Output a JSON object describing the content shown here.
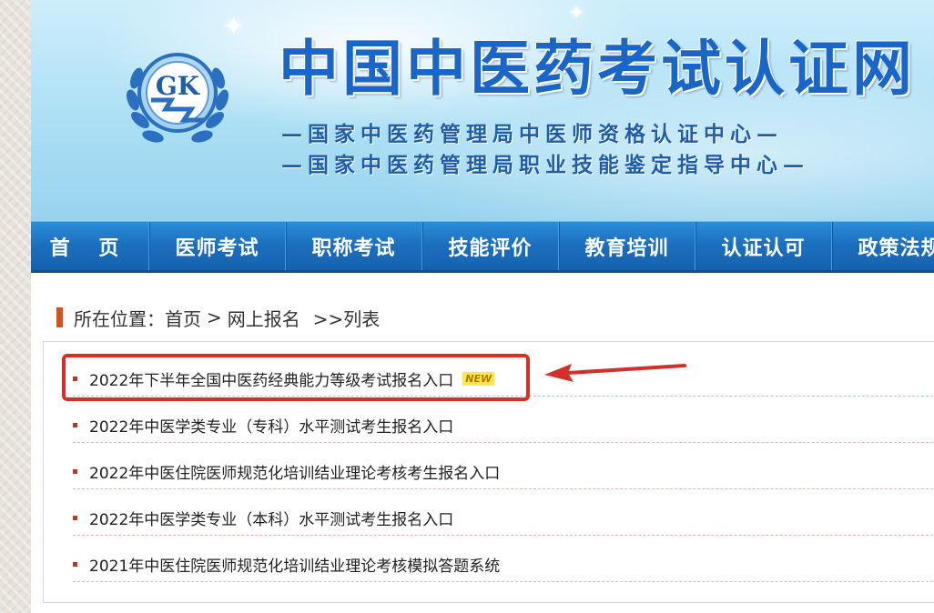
{
  "site": {
    "logo_text": "GK",
    "title": "中国中医药考试认证网",
    "subtitle1": "—国家中医药管理局中医师资格认证中心—",
    "subtitle2": "—国家中医药管理局职业技能鉴定指导中心—"
  },
  "nav": {
    "items": [
      {
        "label": "首 页"
      },
      {
        "label": "医师考试"
      },
      {
        "label": "职称考试"
      },
      {
        "label": "技能评价"
      },
      {
        "label": "教育培训"
      },
      {
        "label": "认证认可"
      },
      {
        "label": "政策法规"
      }
    ]
  },
  "breadcrumb": {
    "prefix": "所在位置：",
    "home": "首页",
    "separator": ">",
    "current": "网上报名",
    "tail": ">>列表"
  },
  "list": {
    "items": [
      {
        "title": "2022年下半年全国中医药经典能力等级考试报名入口",
        "badge": "NEW"
      },
      {
        "title": "2022年中医学类专业（专科）水平测试考生报名入口"
      },
      {
        "title": "2022年中医住院医师规范化培训结业理论考核考生报名入口"
      },
      {
        "title": "2022年中医学类专业（本科）水平测试考生报名入口"
      },
      {
        "title": "2021年中医住院医师规范化培训结业理论考核模拟答题系统"
      }
    ]
  },
  "colors": {
    "nav_bg": "#1c70c0",
    "title": "#1a66c8",
    "annotation_red": "#d3302a",
    "bullet": "#b23a2a"
  },
  "icons": {
    "logo": "gk-emblem-icon",
    "arrow": "red-arrow-icon",
    "badge": "new-badge-icon"
  }
}
